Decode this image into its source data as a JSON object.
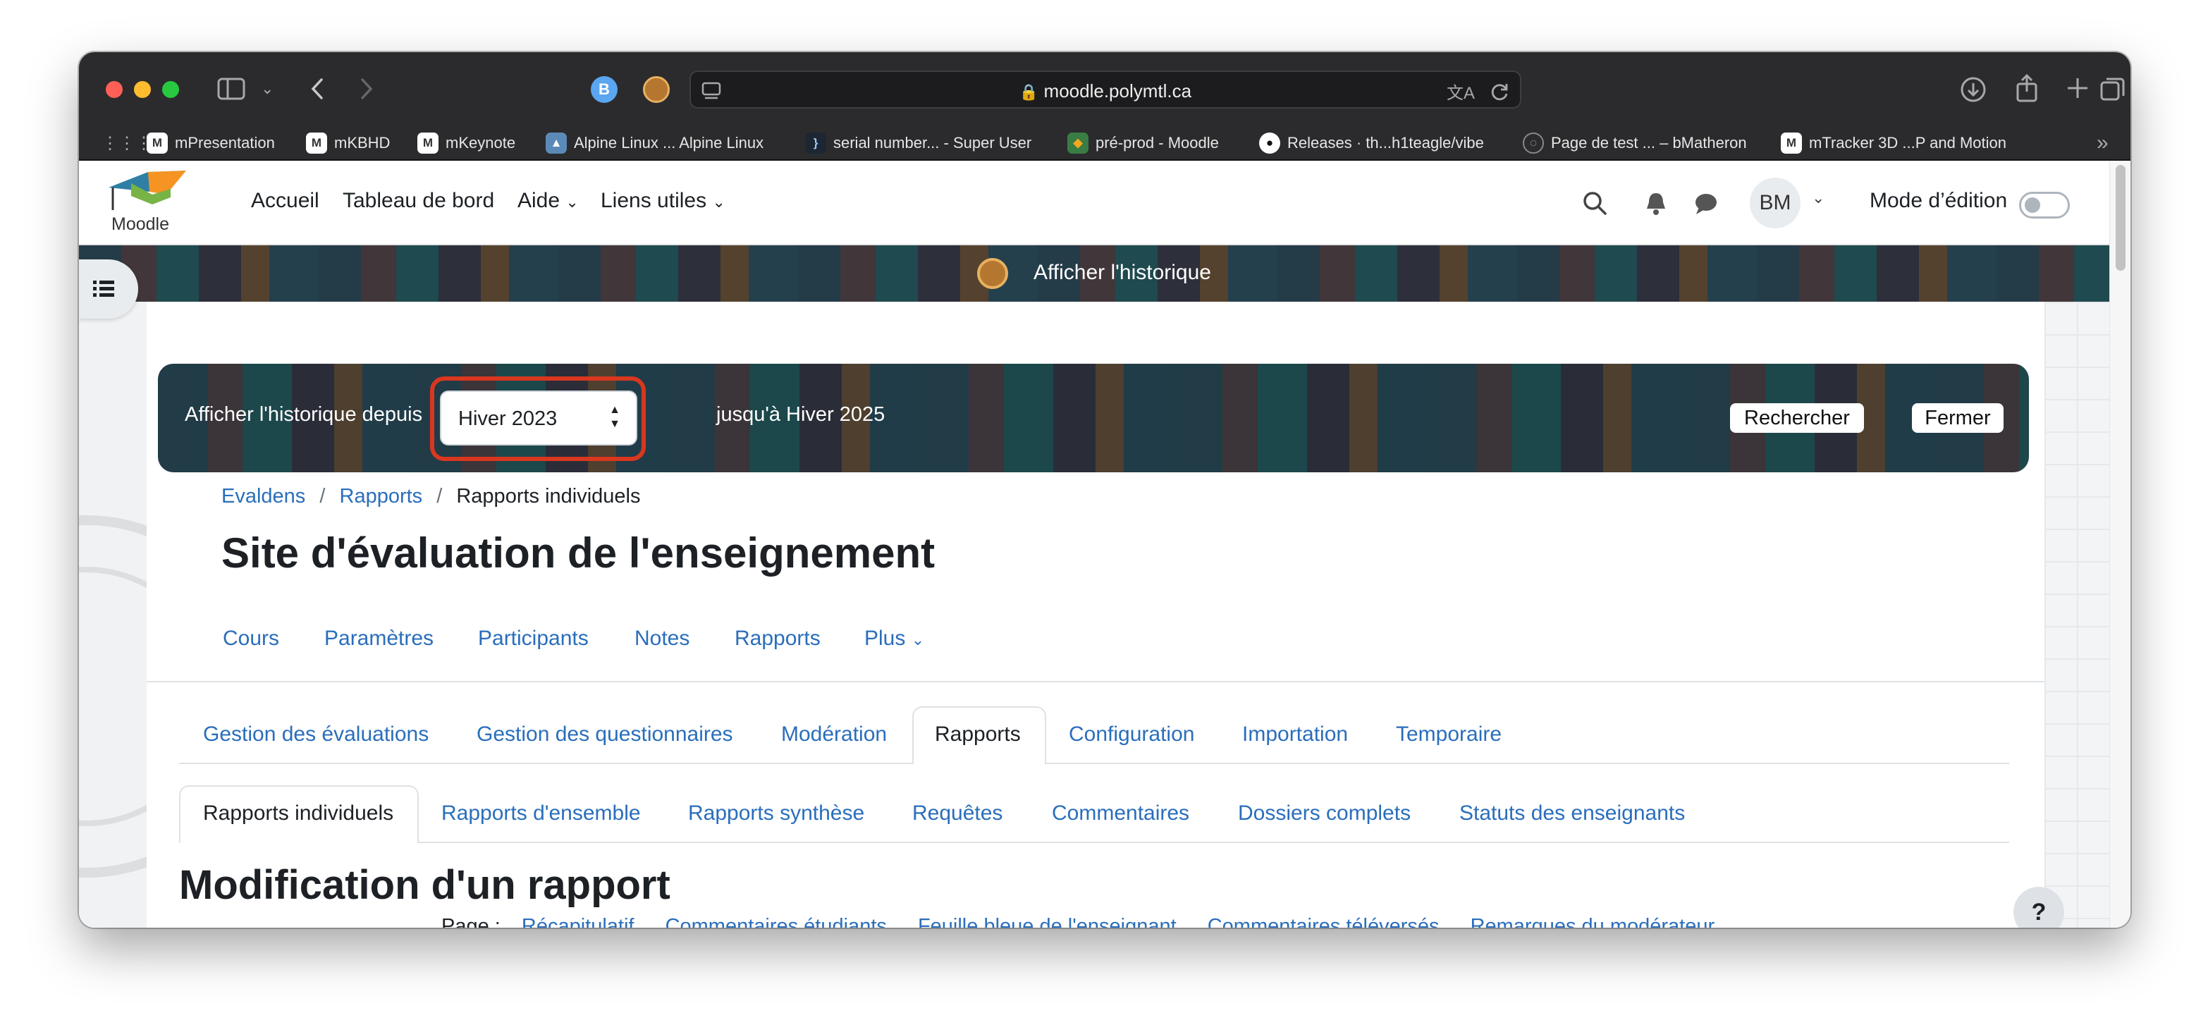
{
  "browser": {
    "url": "moodle.polymtl.ca",
    "profile_badge": "B",
    "bookmarks": [
      {
        "label": "mPresentation",
        "icon": "moodle-m-icon"
      },
      {
        "label": "mKBHD",
        "icon": "moodle-m-icon"
      },
      {
        "label": "mKeynote",
        "icon": "moodle-m-icon"
      },
      {
        "label": "Alpine Linux ... Alpine Linux",
        "icon": "alpine-icon"
      },
      {
        "label": "serial number... - Super User",
        "icon": "superuser-icon"
      },
      {
        "label": "pré-prod - Moodle",
        "icon": "moodle-hat-icon"
      },
      {
        "label": "Releases · th...h1teagle/vibe",
        "icon": "github-icon"
      },
      {
        "label": "Page de test ... – bMatheron",
        "icon": "globe-icon"
      },
      {
        "label": "mTracker 3D ...P and Motion",
        "icon": "moodle-m-icon"
      }
    ]
  },
  "navbar": {
    "logo_text": "Moodle",
    "links": [
      "Accueil",
      "Tableau de bord",
      "Aide",
      "Liens utiles"
    ],
    "avatar_initials": "BM",
    "edit_mode_label": "Mode d’édition"
  },
  "history": {
    "banner_label": "Afficher l'historique",
    "from_label": "Afficher l'historique depuis",
    "selected_term": "Hiver 2023",
    "to_label": "jusqu'à Hiver 2025",
    "search_button": "Rechercher",
    "close_button": "Fermer"
  },
  "breadcrumb": [
    "Evaldens",
    "Rapports",
    "Rapports individuels"
  ],
  "page_title": "Site d'évaluation de l'enseignement",
  "course_nav": [
    "Cours",
    "Paramètres",
    "Participants",
    "Notes",
    "Rapports",
    "Plus"
  ],
  "main_tabs": {
    "items": [
      "Gestion des évaluations",
      "Gestion des questionnaires",
      "Modération",
      "Rapports",
      "Configuration",
      "Importation",
      "Temporaire"
    ],
    "active": "Rapports"
  },
  "sub_tabs": {
    "items": [
      "Rapports individuels",
      "Rapports d'ensemble",
      "Rapports synthèse",
      "Requêtes",
      "Commentaires",
      "Dossiers complets",
      "Statuts des enseignants"
    ],
    "active": "Rapports individuels"
  },
  "report": {
    "heading": "Modification d'un rapport",
    "page_label": "Page :",
    "page_links": [
      "Récapitulatif",
      "Commentaires étudiants",
      "Feuille bleue de l'enseignant",
      "Commentaires téléversés",
      "Remarques du modérateur"
    ]
  },
  "help_button": "?",
  "colors": {
    "link": "#2a6ebb",
    "highlight": "#d9371f",
    "toolbar": "#2b2b2d"
  }
}
